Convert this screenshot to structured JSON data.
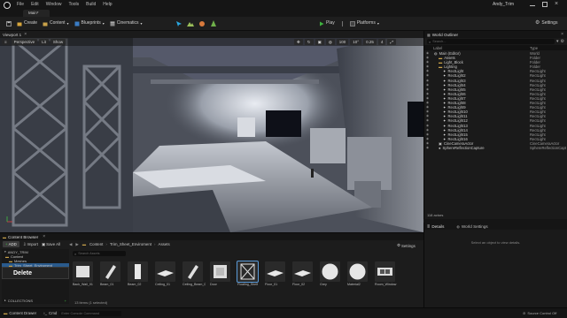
{
  "window": {
    "project_name": "Andy_Trim"
  },
  "menu": [
    "File",
    "Edit",
    "Window",
    "Tools",
    "Build",
    "Help"
  ],
  "tabs": {
    "level": "Main*"
  },
  "toolbar": {
    "save_label": "",
    "create_label": "Create",
    "content_label": "Content",
    "blueprints_label": "Blueprints",
    "cinematics_label": "Cinematics",
    "play_label": "Play",
    "platforms_label": "Platforms",
    "settings_label": "Settings"
  },
  "viewport": {
    "tab_label": "Viewport 1",
    "perspective_label": "Perspective",
    "lit_label": "Lit",
    "show_label": "Show",
    "grid_value": "100",
    "rotate_value": "10°",
    "scale_value": "0.25",
    "camera_speed": "4"
  },
  "outliner": {
    "title": "World Outliner",
    "search_placeholder": "Search...",
    "col_label": "Label",
    "col_type": "Type",
    "rows": [
      {
        "indent": 1,
        "label": "Main (Editor)",
        "type": "World",
        "icon": "world-icon"
      },
      {
        "indent": 2,
        "label": "Assets",
        "type": "Folder",
        "icon": "folder-icon"
      },
      {
        "indent": 2,
        "label": "Light_Block",
        "type": "Folder",
        "icon": "folder-icon"
      },
      {
        "indent": 2,
        "label": "Lighting",
        "type": "Folder",
        "icon": "folder-icon"
      },
      {
        "indent": 3,
        "label": "RectLight",
        "type": "RectLight",
        "icon": "light-icon"
      },
      {
        "indent": 3,
        "label": "RectLight2",
        "type": "RectLight",
        "icon": "light-icon"
      },
      {
        "indent": 3,
        "label": "RectLight3",
        "type": "RectLight",
        "icon": "light-icon"
      },
      {
        "indent": 3,
        "label": "RectLight4",
        "type": "RectLight",
        "icon": "light-icon"
      },
      {
        "indent": 3,
        "label": "RectLight5",
        "type": "RectLight",
        "icon": "light-icon"
      },
      {
        "indent": 3,
        "label": "RectLight6",
        "type": "RectLight",
        "icon": "light-icon"
      },
      {
        "indent": 3,
        "label": "RectLight7",
        "type": "RectLight",
        "icon": "light-icon"
      },
      {
        "indent": 3,
        "label": "RectLight8",
        "type": "RectLight",
        "icon": "light-icon"
      },
      {
        "indent": 3,
        "label": "RectLight9",
        "type": "RectLight",
        "icon": "light-icon"
      },
      {
        "indent": 3,
        "label": "RectLight10",
        "type": "RectLight",
        "icon": "light-icon"
      },
      {
        "indent": 3,
        "label": "RectLight11",
        "type": "RectLight",
        "icon": "light-icon"
      },
      {
        "indent": 3,
        "label": "RectLight12",
        "type": "RectLight",
        "icon": "light-icon"
      },
      {
        "indent": 3,
        "label": "RectLight13",
        "type": "RectLight",
        "icon": "light-icon"
      },
      {
        "indent": 3,
        "label": "RectLight14",
        "type": "RectLight",
        "icon": "light-icon"
      },
      {
        "indent": 3,
        "label": "RectLight15",
        "type": "RectLight",
        "icon": "light-icon"
      },
      {
        "indent": 3,
        "label": "RectLight16",
        "type": "RectLight",
        "icon": "light-icon"
      },
      {
        "indent": 2,
        "label": "CineCameraActor",
        "type": "CineCameraActor",
        "icon": "camera-icon"
      },
      {
        "indent": 2,
        "label": "SphereReflectionCapture",
        "type": "SphereReflectionCapt",
        "icon": "sphere-icon"
      }
    ],
    "actor_count": "118 actors"
  },
  "details": {
    "tab_details": "Details",
    "tab_world_settings": "World Settings",
    "empty_message": "Select an object to view details."
  },
  "content_browser": {
    "tab_label": "Content Browser",
    "add_label": "ADD",
    "import_label": "Import",
    "save_all_label": "Save All",
    "breadcrumb": [
      "Content",
      "Trim_Sheet_Enviroment",
      "Assets"
    ],
    "settings_label": "Settings",
    "favorites_label": "ANDY_TRIM",
    "tree": [
      {
        "label": "Content",
        "indent": 0
      },
      {
        "label": "Meshes",
        "indent": 1
      },
      {
        "label": "Trim_Sheet_Enviroment",
        "indent": 1
      }
    ],
    "context_menu_label": "Delete",
    "collections_label": "COLLECTIONS",
    "search_placeholder": "Search Assets",
    "items_status": "13 items (1 selected)",
    "assets": [
      {
        "label": "Back_Wall_01",
        "shape": "block"
      },
      {
        "label": "Beam_01",
        "shape": "beam"
      },
      {
        "label": "Beam_02",
        "shape": "tall"
      },
      {
        "label": "Ceiling_01",
        "shape": "flat"
      },
      {
        "label": "Ceiling_Beam_01",
        "shape": "beam"
      },
      {
        "label": "Door",
        "shape": "door"
      },
      {
        "label": "Floating_Shelf",
        "shape": "truss"
      },
      {
        "label": "Floor_01",
        "shape": "flat"
      },
      {
        "label": "Floor_02",
        "shape": "flat"
      },
      {
        "label": "Grey",
        "shape": "sphere"
      },
      {
        "label": "Material2",
        "shape": "sphere"
      },
      {
        "label": "Room_Window",
        "shape": "window"
      }
    ]
  },
  "statusbar": {
    "content_drawer": "Content Drawer",
    "cmd_label": "Cmd",
    "cmd_placeholder": "Enter Console Command",
    "source_control": "Source Control Off"
  },
  "colors": {
    "accent_play": "#3fb33f",
    "selection_blue": "#2a5a8c",
    "folder": "#c9a24a"
  }
}
